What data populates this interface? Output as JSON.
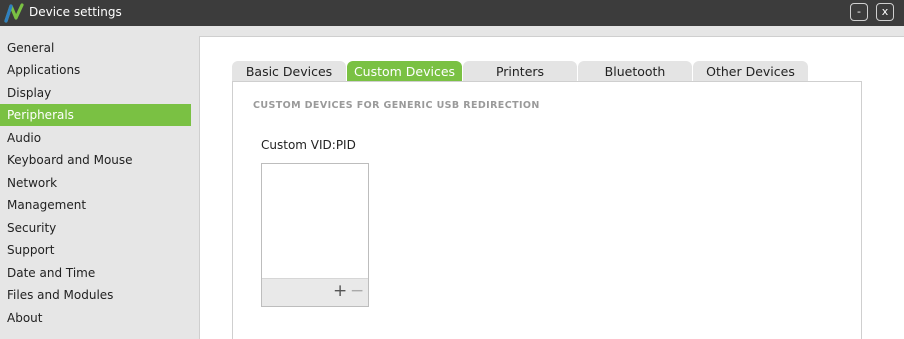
{
  "window": {
    "title": "Device settings",
    "minimize_label": "-",
    "close_label": "x"
  },
  "colors": {
    "accent": "#7ac143",
    "titlebar": "#3c3c3c",
    "sidebar_bg": "#e6e6e6"
  },
  "sidebar": {
    "items": [
      {
        "label": "General"
      },
      {
        "label": "Applications"
      },
      {
        "label": "Display"
      },
      {
        "label": "Peripherals",
        "active": true
      },
      {
        "label": "Audio"
      },
      {
        "label": "Keyboard and Mouse"
      },
      {
        "label": "Network"
      },
      {
        "label": "Management"
      },
      {
        "label": "Security"
      },
      {
        "label": "Support"
      },
      {
        "label": "Date and Time"
      },
      {
        "label": "Files and Modules"
      },
      {
        "label": "About"
      }
    ]
  },
  "tabs": [
    {
      "label": "Basic Devices"
    },
    {
      "label": "Custom Devices",
      "active": true
    },
    {
      "label": "Printers"
    },
    {
      "label": "Bluetooth"
    },
    {
      "label": "Other Devices"
    }
  ],
  "content": {
    "section_header": "CUSTOM DEVICES FOR GENERIC USB REDIRECTION",
    "list_label": "Custom  VID:PID",
    "items": [],
    "add_label": "+",
    "remove_label": "−"
  },
  "icons": {
    "logo": "app-logo-icon",
    "add": "plus-icon",
    "remove": "minus-icon"
  }
}
